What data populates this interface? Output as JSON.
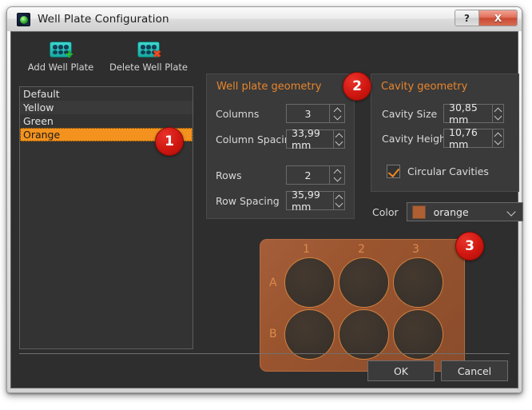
{
  "window": {
    "title": "Well Plate Configuration",
    "app_icon": "well-plate-app-icon",
    "help_button": "?",
    "close_button": "X"
  },
  "toolbar": {
    "add_label": "Add Well Plate",
    "delete_label": "Delete Well Plate",
    "add_icon": "well-plate-add-icon",
    "delete_icon": "well-plate-delete-icon"
  },
  "plate_list": {
    "items": [
      {
        "label": "Default",
        "selected": false
      },
      {
        "label": "Yellow",
        "selected": false
      },
      {
        "label": "Green",
        "selected": false
      },
      {
        "label": "Orange",
        "selected": true
      }
    ]
  },
  "well_plate_geometry": {
    "title": "Well plate geometry",
    "columns_label": "Columns",
    "columns_value": "3",
    "column_spacing_label": "Column Spacing",
    "column_spacing_value": "33,99 mm",
    "rows_label": "Rows",
    "rows_value": "2",
    "row_spacing_label": "Row Spacing",
    "row_spacing_value": "35,99 mm"
  },
  "cavity_geometry": {
    "title": "Cavity geometry",
    "cavity_size_label": "Cavity Size",
    "cavity_size_value": "30,85 mm",
    "cavity_height_label": "Cavity Height",
    "cavity_height_value": "10,76 mm",
    "circular_cavities_label": "Circular Cavities",
    "circular_cavities_checked": true
  },
  "color_select": {
    "label": "Color",
    "value": "orange",
    "swatch_hex": "#b05f33"
  },
  "preview": {
    "column_labels": [
      "1",
      "2",
      "3"
    ],
    "row_labels": [
      "A",
      "B"
    ],
    "plate_color_hex": "#9a552f",
    "well_outline_hex": "#d1813f",
    "wells": 6
  },
  "footer": {
    "ok_label": "OK",
    "cancel_label": "Cancel"
  },
  "annotations": {
    "one": "1",
    "two": "2",
    "three": "3"
  }
}
